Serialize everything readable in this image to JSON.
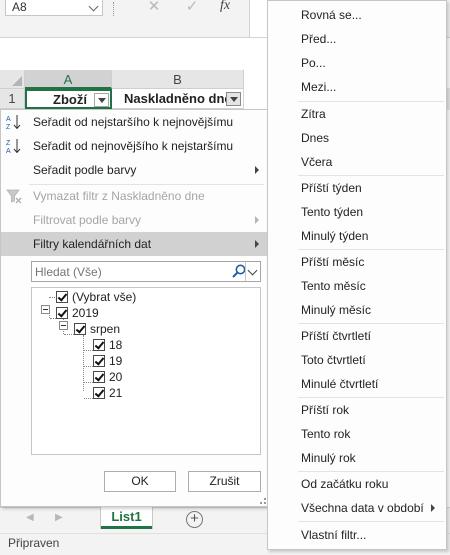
{
  "namebox": {
    "value": "A8"
  },
  "formula_bar": {
    "cancel_glyph": "✕",
    "enter_glyph": "✓",
    "fx_label": "fx"
  },
  "columns": [
    "A",
    "B"
  ],
  "row": {
    "number": "1",
    "header_a": "Zboží",
    "header_b": "Naskladněno dne"
  },
  "filter_panel": {
    "sort_asc": "Seřadit od nejstaršího k nejnovějšímu",
    "sort_desc": "Seřadit od nejnovějšího k nejstaršímu",
    "sort_color": "Seřadit podle barvy",
    "clear_filter": "Vymazat filtr z Naskladněno dne",
    "filter_color": "Filtrovat podle barvy",
    "date_filters": "Filtry kalendářních dat",
    "search_placeholder": "Hledat (Vše)",
    "tree": {
      "select_all": "(Vybrat vše)",
      "year": "2019",
      "month": "srpen",
      "days": [
        "18",
        "19",
        "20",
        "21"
      ]
    },
    "ok": "OK",
    "cancel": "Zrušit"
  },
  "date_submenu": {
    "groups": [
      [
        "Rovná se...",
        "Před...",
        "Po...",
        "Mezi..."
      ],
      [
        "Zítra",
        "Dnes",
        "Včera"
      ],
      [
        "Příští týden",
        "Tento týden",
        "Minulý týden"
      ],
      [
        "Příští měsíc",
        "Tento měsíc",
        "Minulý měsíc"
      ],
      [
        "Příští čtvrtletí",
        "Toto čtvrtletí",
        "Minulé čtvrtletí"
      ],
      [
        "Příští rok",
        "Tento rok",
        "Minulý rok"
      ],
      [
        "Od začátku roku",
        "Všechna data v období"
      ],
      [
        "Vlastní filtr..."
      ]
    ]
  },
  "sheet_tabs": [
    "List1"
  ],
  "add_sheet_glyph": "+",
  "status": "Připraven",
  "colors": {
    "excel_green": "#217346",
    "menu_hover": "#d1d1d1",
    "disabled_text": "#a5a5a5"
  },
  "icons": [
    "sort-ascending-icon",
    "sort-descending-icon",
    "clear-filter-icon",
    "search-icon",
    "checkbox-icon",
    "collapse-icon",
    "add-sheet-icon"
  ]
}
